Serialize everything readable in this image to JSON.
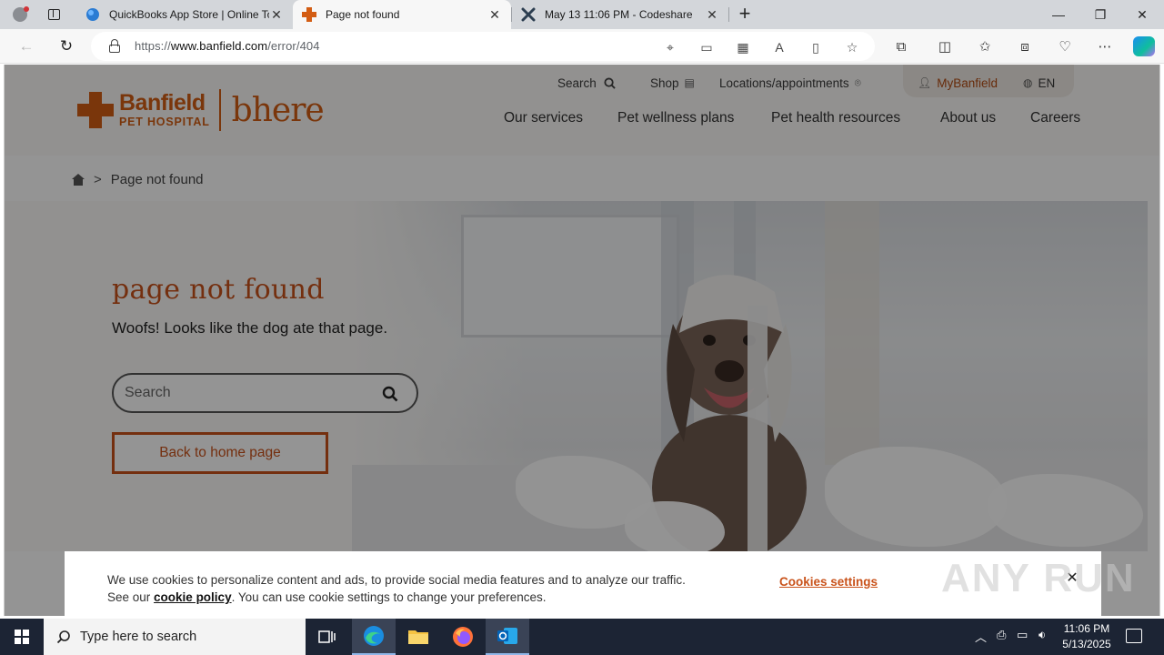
{
  "browser": {
    "tabs": [
      {
        "title": "QuickBooks App Store | Online To",
        "active": false
      },
      {
        "title": "Page not found",
        "active": true
      },
      {
        "title": "May 13 11:06 PM - Codeshare",
        "active": false
      }
    ],
    "url_prefix": "https://",
    "url_domain": "www.banfield.com",
    "url_path": "/error/404"
  },
  "site": {
    "logo_name": "Banfield",
    "logo_sub": "PET HOSPITAL",
    "logo_tagline": "bhere",
    "utility": {
      "search": "Search",
      "shop": "Shop",
      "locations": "Locations/appointments",
      "mybanfield": "MyBanfield",
      "language": "EN"
    },
    "nav": [
      "Our services",
      "Pet wellness plans",
      "Pet health resources",
      "About us",
      "Careers"
    ],
    "breadcrumb_current": "Page not found",
    "hero": {
      "title": "page not found",
      "subtitle": "Woofs! Looks like the dog ate that page.",
      "search_placeholder": "Search",
      "home_button": "Back to home page"
    },
    "cookie": {
      "text_before": "We use cookies to personalize content and ads, to provide social media features and to analyze our traffic. See our ",
      "link": "cookie policy",
      "text_after": ". You can use cookie settings to change your preferences.",
      "settings": "Cookies settings"
    }
  },
  "watermark": "ANY RUN",
  "taskbar": {
    "search_placeholder": "Type here to search",
    "time": "11:06 PM",
    "date": "5/13/2025"
  },
  "colors": {
    "brand_orange": "#d35d14",
    "overlay": "rgba(0,0,0,0.42)",
    "taskbar": "#1c2434"
  }
}
